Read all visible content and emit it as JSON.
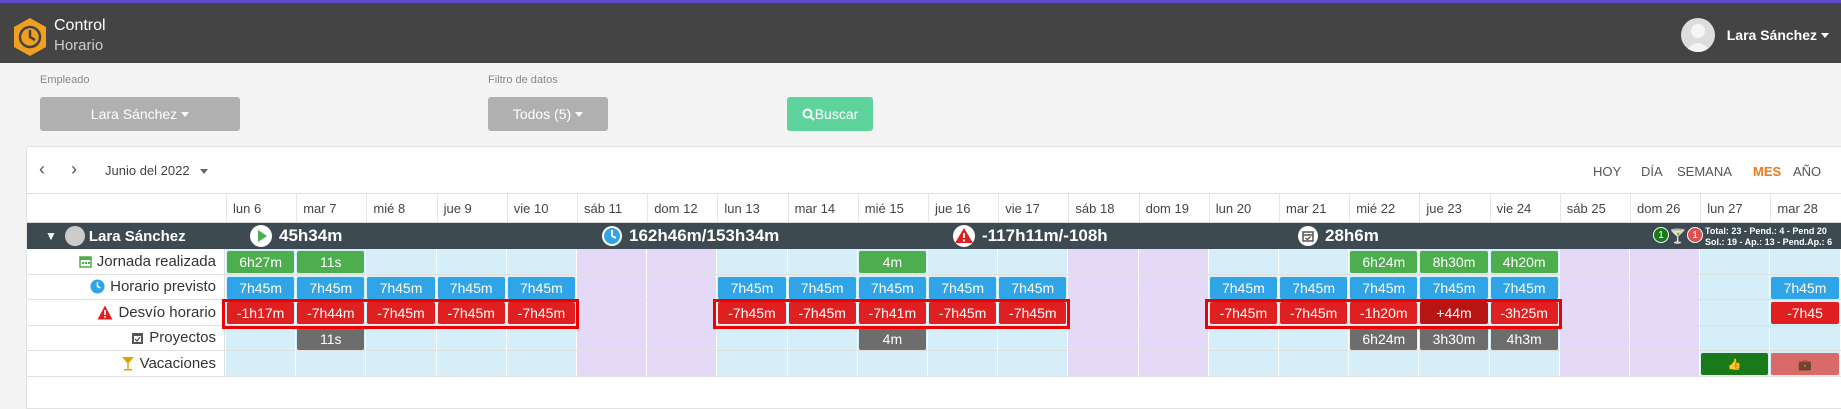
{
  "brand": {
    "line1": "Control",
    "line2": "Horario"
  },
  "user": {
    "name": "Lara Sánchez"
  },
  "filters": {
    "employee_label": "Empleado",
    "employee_value": "Lara Sánchez",
    "filter_label": "Filtro de datos",
    "filter_value": "Todos (5)",
    "search_label": "Buscar"
  },
  "calendar": {
    "month": "Junio del 2022",
    "views": [
      "HOY",
      "DÍA",
      "SEMANA",
      "MES",
      "AÑO"
    ],
    "active_view": "MES",
    "days": [
      "lun 6",
      "mar 7",
      "mié 8",
      "jue 9",
      "vie 10",
      "sáb 11",
      "dom 12",
      "lun 13",
      "mar 14",
      "mié 15",
      "jue 16",
      "vie 17",
      "sáb 18",
      "dom 19",
      "lun 20",
      "mar 21",
      "mié 22",
      "jue 23",
      "vie 24",
      "sáb 25",
      "dom 26",
      "lun 27",
      "mar 28"
    ],
    "weekend": [
      5,
      6,
      12,
      13,
      19,
      20
    ]
  },
  "summary": {
    "name": "Lara Sánchez",
    "worked": "45h34m",
    "planned": "162h46m/153h34m",
    "deviation": "-117h11m/-108h",
    "projects": "28h6m",
    "badge_green": "1",
    "badge_red": "1",
    "totals_line1": "Total: 23 - Pend.: 4 - Pend 20",
    "totals_line2": "Sol.: 19 - Ap.: 13 - Pend.Ap.: 6"
  },
  "rows": [
    {
      "label": "Jornada realizada",
      "icon": "calendar-icon",
      "color": "#4cae4c",
      "cells": {
        "0": "6h27m",
        "1": "11s",
        "9": "4m",
        "16": "6h24m",
        "17": "8h30m",
        "18": "4h20m"
      }
    },
    {
      "label": "Horario previsto",
      "icon": "clock-icon",
      "color": "#2fa4e7",
      "cells": {
        "0": "7h45m",
        "1": "7h45m",
        "2": "7h45m",
        "3": "7h45m",
        "4": "7h45m",
        "7": "7h45m",
        "8": "7h45m",
        "9": "7h45m",
        "10": "7h45m",
        "11": "7h45m",
        "14": "7h45m",
        "15": "7h45m",
        "16": "7h45m",
        "17": "7h45m",
        "18": "7h45m",
        "22": "7h45m"
      }
    },
    {
      "label": "Desvío horario",
      "icon": "warning-icon",
      "color": "#e02020",
      "cells": {
        "0": "-1h17m",
        "1": "-7h44m",
        "2": "-7h45m",
        "3": "-7h45m",
        "4": "-7h45m",
        "7": "-7h45m",
        "8": "-7h45m",
        "9": "-7h41m",
        "10": "-7h45m",
        "11": "-7h45m",
        "14": "-7h45m",
        "15": "-7h45m",
        "16": "-1h20m",
        "17": "+44m",
        "18": "-3h25m",
        "22": "-7h45"
      }
    },
    {
      "label": "Proyectos",
      "icon": "calendar-check-icon",
      "color": "#6d6d6d",
      "cells": {
        "1": "11s",
        "9": "4m",
        "16": "6h24m",
        "17": "3h30m",
        "18": "4h3m"
      }
    },
    {
      "label": "Vacaciones",
      "icon": "cocktail-icon",
      "color": "#e0a400",
      "cells": {}
    }
  ]
}
